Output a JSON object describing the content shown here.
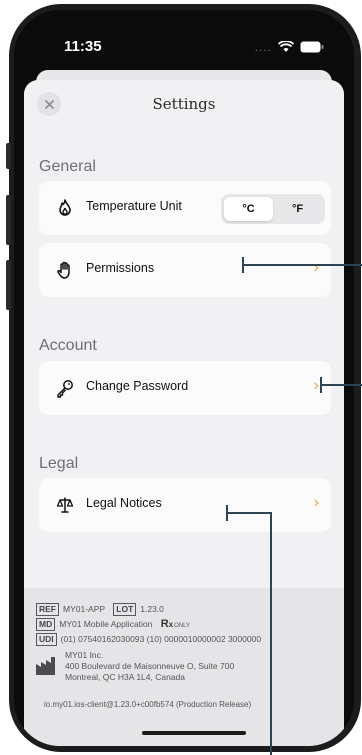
{
  "status_bar": {
    "time": "11:35",
    "dots": "....",
    "icons": [
      "wifi-icon",
      "battery-icon"
    ]
  },
  "header": {
    "title": "Settings",
    "close_icon": "close-icon"
  },
  "sections": {
    "general": {
      "title": "General",
      "temperature": {
        "label": "Temperature Unit",
        "icon": "flame-icon",
        "options": [
          "°C",
          "°F"
        ],
        "selected": "°C"
      },
      "permissions": {
        "label": "Permissions",
        "icon": "hand-icon"
      }
    },
    "account": {
      "title": "Account",
      "change_password": {
        "label": "Change Password",
        "icon": "key-icon"
      }
    },
    "legal": {
      "title": "Legal",
      "legal_notices": {
        "label": "Legal Notices",
        "icon": "scale-icon"
      }
    }
  },
  "chevron": "›",
  "footer": {
    "ref_tag": "REF",
    "ref_value": "MY01-APP",
    "lot_tag": "LOT",
    "lot_value": "1.23.0",
    "md_tag": "MD",
    "md_value": "MY01 Mobile Application",
    "rx": "R",
    "rx_only": "ONLY",
    "udi_tag": "UDI",
    "udi_value": "(01) 07540162030093 (10) 0000010000002 3000000",
    "manufacturer": [
      "MY01 Inc.",
      "400 Boulevard de Maisonneuve O, Suite 700",
      "Montreal, QC H3A 1L4, Canada"
    ],
    "build": "io.my01.ios-client@1.23.0+c00fb574 (Production Release)"
  },
  "colors": {
    "accent": "#f0a33c",
    "annotation": "#2c4452"
  }
}
